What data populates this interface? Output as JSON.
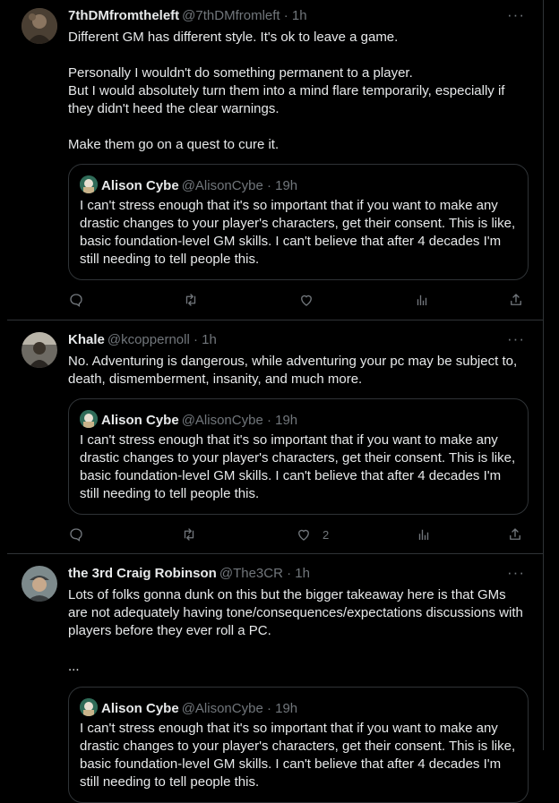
{
  "more_label": "···",
  "quoted": {
    "name": "Alison Cybe",
    "handle": "@AlisonCybe · 19h",
    "text": "I can't stress enough that it's so important that if you want to make any drastic changes to your player's characters, get their consent. This is like, basic foundation-level GM skills. I can't believe that after 4 decades I'm still needing to tell people this."
  },
  "tweets": [
    {
      "name": "7thDMfromtheleft",
      "handle": "@7thDMfromleft · 1h",
      "text": "Different GM has different style. It's ok to leave a game.\n\nPersonally I wouldn't do something permanent to a player.\nBut I would absolutely turn them into a mind flare temporarily, especially if they didn't heed the clear warnings.\n\nMake them go on a quest to cure it.",
      "like_count": ""
    },
    {
      "name": "Khale",
      "handle": "@kcoppernoll · 1h",
      "text": "No. Adventuring is dangerous, while adventuring your pc may be subject to, death, dismemberment, insanity, and much more.",
      "like_count": "2"
    },
    {
      "name": "the 3rd Craig Robinson",
      "handle": "@The3CR · 1h",
      "text": "Lots of folks gonna dunk on this but the bigger takeaway here is that GMs are not adequately having tone/consequences/expectations discussions with players before they ever roll a PC.\n\n...",
      "like_count": ""
    }
  ],
  "colors": {
    "background": "#000000",
    "text": "#e7e9ea",
    "muted": "#71767b",
    "border": "#2f3336"
  }
}
